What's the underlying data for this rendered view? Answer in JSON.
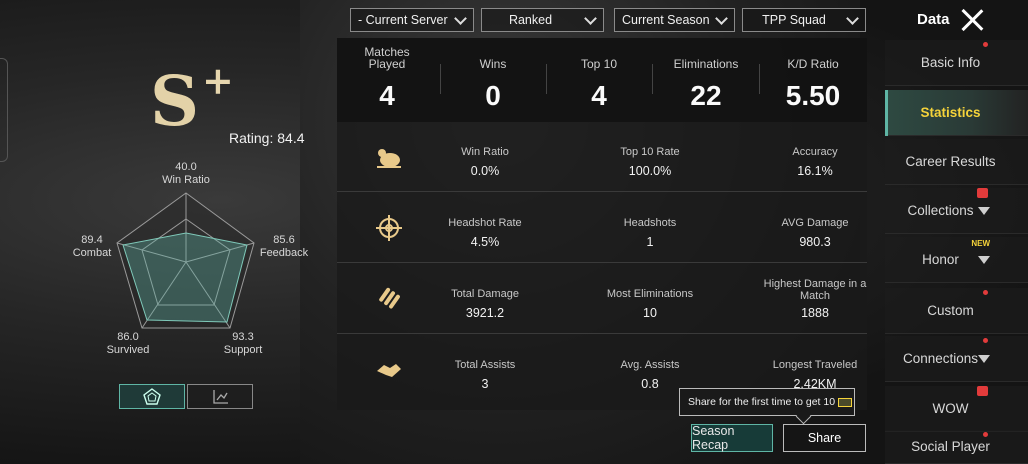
{
  "filters": [
    {
      "label": "- Current Server"
    },
    {
      "label": "Ranked"
    },
    {
      "label": "Current Season"
    },
    {
      "label": "TPP Squad"
    }
  ],
  "header": {
    "title": "Data"
  },
  "sidebar": {
    "items": [
      {
        "label": "Basic Info",
        "badge": "dot"
      },
      {
        "label": "Statistics",
        "active": true
      },
      {
        "label": "Career Results"
      },
      {
        "label": "Collections",
        "badge": "gift",
        "expandable": true
      },
      {
        "label": "Honor",
        "badge": "NEW",
        "expandable": true
      },
      {
        "label": "Custom",
        "badge": "dot"
      },
      {
        "label": "Connections",
        "badge": "dot",
        "expandable": true
      },
      {
        "label": "WOW",
        "badge": "gift"
      },
      {
        "label": "Social Player",
        "badge": "dot"
      }
    ]
  },
  "summary": [
    {
      "label": "Matches Played",
      "value": "4"
    },
    {
      "label": "Wins",
      "value": "0"
    },
    {
      "label": "Top 10",
      "value": "4"
    },
    {
      "label": "Eliminations",
      "value": "22"
    },
    {
      "label": "K/D Ratio",
      "value": "5.50"
    }
  ],
  "rows": [
    {
      "icon": "chicken-icon",
      "cells": [
        {
          "label": "Win Ratio",
          "value": "0.0%"
        },
        {
          "label": "Top 10 Rate",
          "value": "100.0%"
        },
        {
          "label": "Accuracy",
          "value": "16.1%"
        }
      ]
    },
    {
      "icon": "crosshair-icon",
      "cells": [
        {
          "label": "Headshot Rate",
          "value": "4.5%"
        },
        {
          "label": "Headshots",
          "value": "1"
        },
        {
          "label": "AVG Damage",
          "value": "980.3"
        }
      ]
    },
    {
      "icon": "bullets-icon",
      "cells": [
        {
          "label": "Total Damage",
          "value": "3921.2"
        },
        {
          "label": "Most Eliminations",
          "value": "10"
        },
        {
          "label": "Highest Damage in a Match",
          "value": "1888"
        }
      ]
    },
    {
      "icon": "handshake-icon",
      "cells": [
        {
          "label": "Total Assists",
          "value": "3"
        },
        {
          "label": "Avg. Assists",
          "value": "0.8"
        },
        {
          "label": "Longest Traveled",
          "value": "2.42KM"
        }
      ]
    }
  ],
  "rank": {
    "tier": "S",
    "modifier": "+",
    "rating_label": "Rating: 84.4"
  },
  "radar": {
    "win_ratio": {
      "value": "40.0",
      "label": "Win Ratio"
    },
    "feedback": {
      "value": "85.6",
      "label": "Feedback"
    },
    "support": {
      "value": "93.3",
      "label": "Support"
    },
    "survived": {
      "value": "86.0",
      "label": "Survived"
    },
    "combat": {
      "value": "89.4",
      "label": "Combat"
    }
  },
  "tooltip": {
    "text": "Share for the first time to get 10"
  },
  "buttons": {
    "season_recap": "Season Recap",
    "share": "Share"
  },
  "colors": {
    "accent": "#5fb5a5",
    "highlight": "#f5d33a",
    "badge": "#e23b3b"
  }
}
